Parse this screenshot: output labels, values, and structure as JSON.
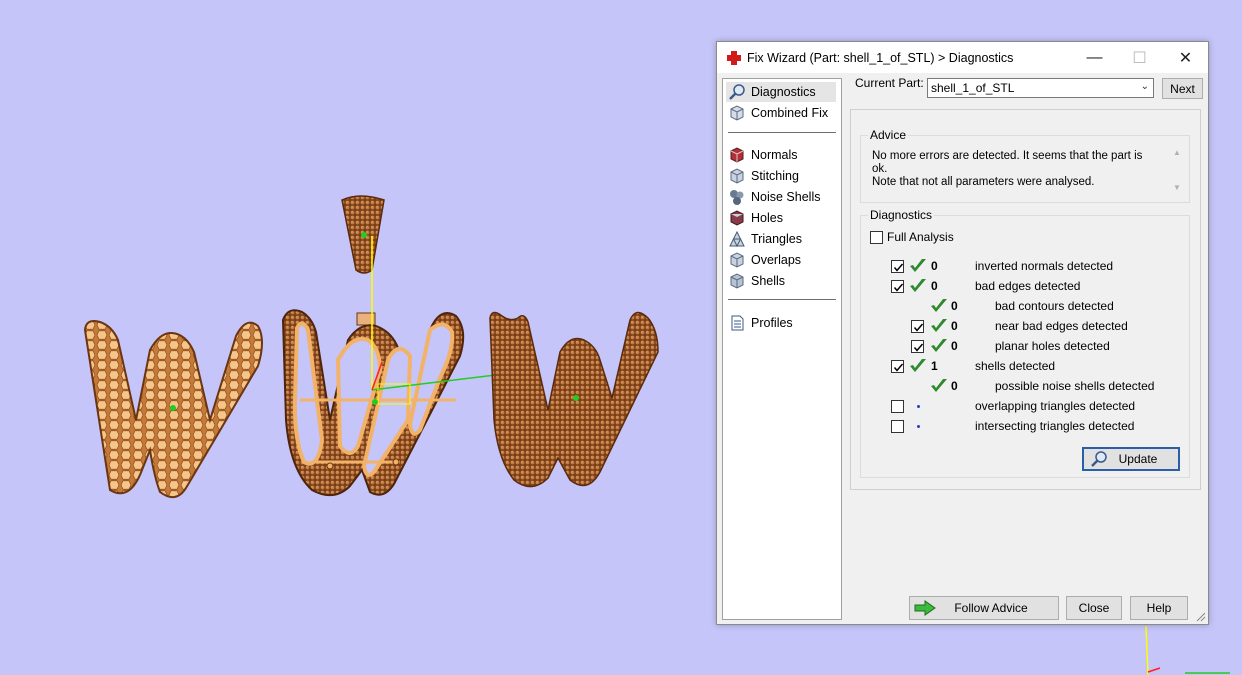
{
  "window": {
    "title": "Fix Wizard (Part: shell_1_of_STL) > Diagnostics",
    "minimize_glyph": "—",
    "maximize_glyph": "☐",
    "close_glyph": "✕"
  },
  "nav": {
    "top_items": [
      {
        "label": "Diagnostics",
        "icon": "magnifier-icon",
        "selected": true
      },
      {
        "label": "Combined Fix",
        "icon": "cube-icon"
      }
    ],
    "fix_items": [
      {
        "label": "Normals",
        "icon": "normals-cube-icon"
      },
      {
        "label": "Stitching",
        "icon": "stitching-cube-icon"
      },
      {
        "label": "Noise Shells",
        "icon": "noise-shells-icon"
      },
      {
        "label": "Holes",
        "icon": "holes-cube-icon"
      },
      {
        "label": "Triangles",
        "icon": "triangles-icon"
      },
      {
        "label": "Overlaps",
        "icon": "overlaps-cube-icon"
      },
      {
        "label": "Shells",
        "icon": "shells-cube-icon"
      }
    ],
    "bottom_items": [
      {
        "label": "Profiles",
        "icon": "document-icon"
      }
    ]
  },
  "current_part": {
    "label": "Current Part:",
    "value": "shell_1_of_STL",
    "next_label": "Next"
  },
  "advice": {
    "title": "Advice",
    "text": "No more errors are detected. It seems that the part is ok.\nNote that not all parameters were analysed."
  },
  "diagnostics": {
    "title": "Diagnostics",
    "full_analysis_label": "Full Analysis",
    "full_analysis_checked": false,
    "rows": [
      {
        "label": "inverted normals detected",
        "count": "0",
        "checked": true,
        "status": "ok"
      },
      {
        "label": "bad edges detected",
        "count": "0",
        "checked": true,
        "status": "ok"
      },
      {
        "label": "bad contours detected",
        "count": "0",
        "status": "ok"
      },
      {
        "label": "near bad edges detected",
        "count": "0",
        "checked": true,
        "status": "ok"
      },
      {
        "label": "planar holes detected",
        "count": "0",
        "checked": true,
        "status": "ok"
      },
      {
        "label": "shells detected",
        "count": "1",
        "checked": true,
        "status": "ok"
      },
      {
        "label": "possible noise shells detected",
        "count": "0",
        "status": "ok"
      },
      {
        "label": "overlapping triangles detected",
        "count": "",
        "checked": false,
        "status": "pending"
      },
      {
        "label": "intersecting triangles detected",
        "count": "",
        "checked": false,
        "status": "pending"
      }
    ],
    "update_label": "Update"
  },
  "footer": {
    "follow_label": "Follow Advice",
    "close_label": "Close",
    "help_label": "Help"
  },
  "colors": {
    "viewport_bg": "#c5c5f9",
    "model_light": "#f2b267",
    "model_dark": "#8a4a20",
    "check_green": "#2f8a2f",
    "axis_yellow": "#ffff00",
    "axis_green": "#22cc22"
  }
}
